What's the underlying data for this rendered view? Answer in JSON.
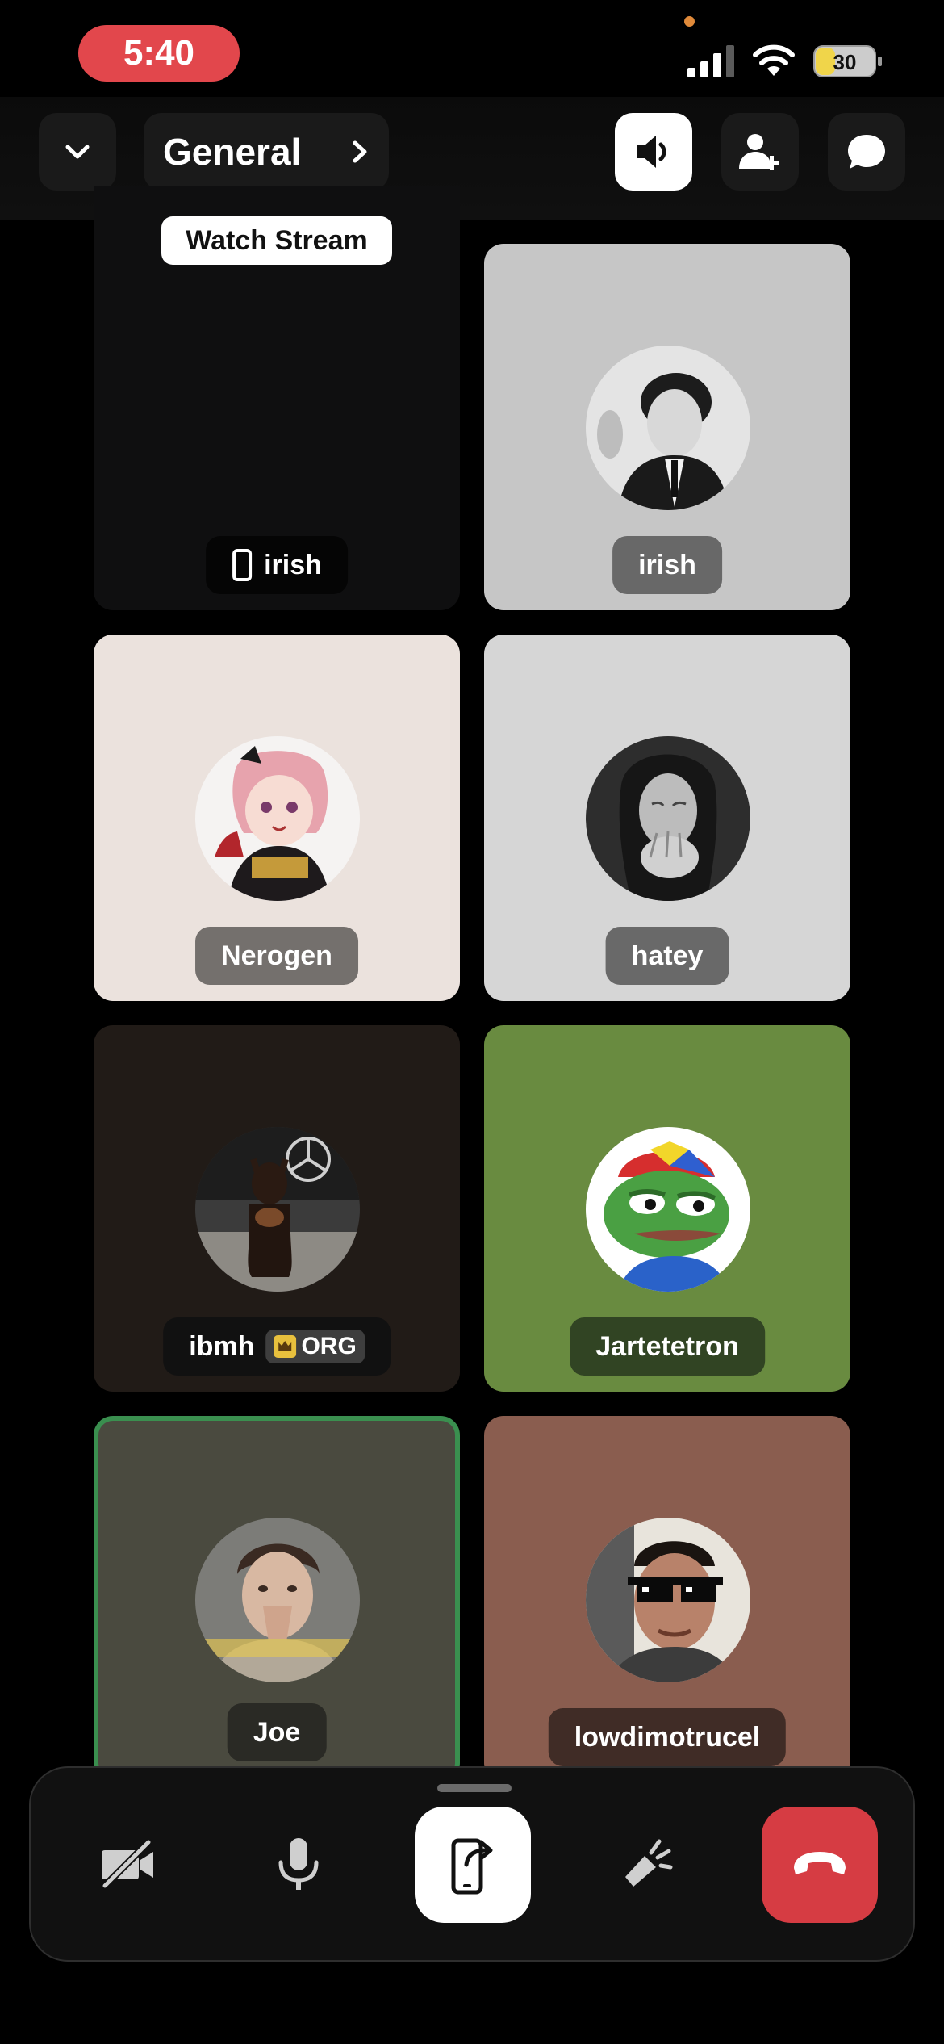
{
  "status": {
    "time": "5:40",
    "battery": "30"
  },
  "header": {
    "channel_name": "General",
    "icons": [
      "chevron-down-icon",
      "chevron-right-icon",
      "speaker-icon",
      "add-user-icon",
      "chat-bubble-icon"
    ]
  },
  "stream_tile": {
    "watch_label": "Watch Stream",
    "user": "irish",
    "icon": "phone-icon"
  },
  "participants": [
    {
      "name": "irish"
    },
    {
      "name": "Nerogen"
    },
    {
      "name": "hatey"
    },
    {
      "name": "ibmh",
      "badge": "ORG"
    },
    {
      "name": "Jartetetron"
    },
    {
      "name": "Joe",
      "speaking": true
    },
    {
      "name": "lowdimotrucel"
    }
  ],
  "controls": {
    "icons": [
      "camera-off-icon",
      "microphone-icon",
      "screen-share-icon",
      "soundboard-icon",
      "hang-up-icon"
    ]
  },
  "colors": {
    "time_pill": "#e2474c",
    "hangup": "#d63c43",
    "speaking_border": "#3a8f4f",
    "jartetetron_tile": "#698b40"
  }
}
